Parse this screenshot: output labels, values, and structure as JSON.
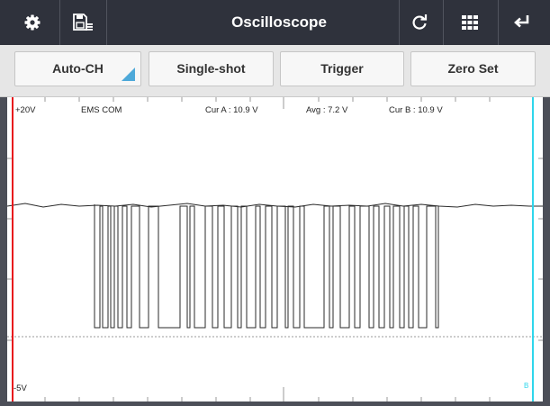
{
  "header": {
    "title": "Oscilloscope",
    "icons": [
      "gear-icon",
      "save-icon",
      "refresh-icon",
      "grid-icon",
      "back-icon"
    ]
  },
  "toolbar": {
    "buttons": [
      {
        "label": "Auto-CH"
      },
      {
        "label": "Single-shot"
      },
      {
        "label": "Trigger"
      },
      {
        "label": "Zero Set"
      }
    ]
  },
  "scope": {
    "top_voltage": "+20V",
    "bottom_voltage": "-5V",
    "channel_name": "EMS COM",
    "cursor_a": "Cur A : 10.9 V",
    "average": "Avg : 7.2 V",
    "cursor_b": "Cur B : 10.9 V",
    "cursor_b_marker": "B",
    "colors": {
      "cursor_a": "#e8161c",
      "cursor_b": "#2fd6ec",
      "accent": "#4ea9d9",
      "header": "#2f323c"
    }
  }
}
